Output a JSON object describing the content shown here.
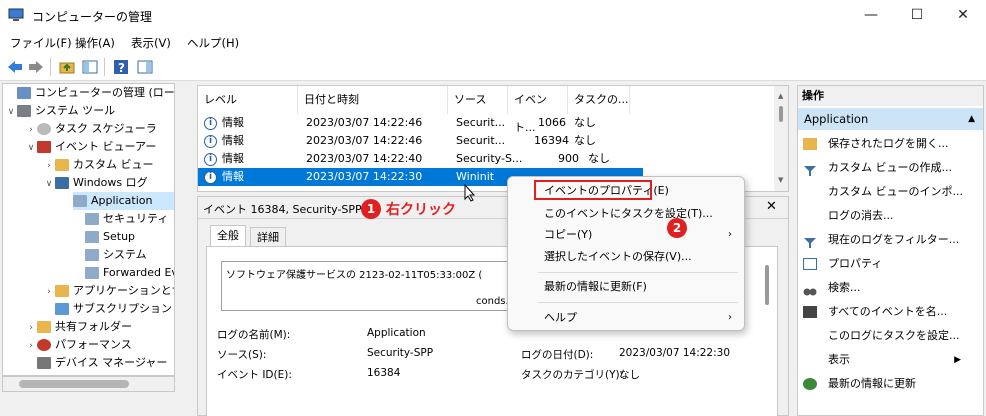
{
  "window": {
    "title": "コンピューターの管理",
    "minimize": "—",
    "maximize": "☐",
    "close": "✕"
  },
  "menu": [
    "ファイル(F)",
    "操作(A)",
    "表示(V)",
    "ヘルプ(H)"
  ],
  "tree": [
    {
      "label": "コンピューターの管理 (ローカル)"
    },
    {
      "label": "システム ツール"
    },
    {
      "label": "タスク スケジューラ"
    },
    {
      "label": "イベント ビューアー"
    },
    {
      "label": "カスタム ビュー"
    },
    {
      "label": "Windows ログ"
    },
    {
      "label": "Application"
    },
    {
      "label": "セキュリティ"
    },
    {
      "label": "Setup"
    },
    {
      "label": "システム"
    },
    {
      "label": "Forwarded Ev"
    },
    {
      "label": "アプリケーションとサ"
    },
    {
      "label": "サブスクリプション"
    },
    {
      "label": "共有フォルダー"
    },
    {
      "label": "パフォーマンス"
    },
    {
      "label": "デバイス マネージャー"
    }
  ],
  "list": {
    "headers": [
      "レベル",
      "日付と時刻",
      "ソース",
      "イベント...",
      "タスクの..."
    ],
    "rows": [
      {
        "level": "情報",
        "date": "2023/03/07 14:22:46",
        "source": "Securit...",
        "id": "1066",
        "task": "なし"
      },
      {
        "level": "情報",
        "date": "2023/03/07 14:22:46",
        "source": "Securit...",
        "id": "16394",
        "task": "なし"
      },
      {
        "level": "情報",
        "date": "2023/03/07 14:22:40",
        "source": "Security-S...",
        "id": "900",
        "task": "なし"
      },
      {
        "level": "情報",
        "date": "2023/03/07 14:22:30",
        "source": "Wininit",
        "id": "",
        "task": ""
      }
    ]
  },
  "detail": {
    "header": "イベント 16384, Security-SPP",
    "tabs": [
      "全般",
      "詳細"
    ],
    "description": "ソフトウェア保護サービスの 2123-02-11T05:33:00Z (",
    "description2": "conds.",
    "fields": {
      "log_name_label": "ログの名前(M):",
      "log_name_value": "Application",
      "source_label": "ソース(S):",
      "source_value": "Security-SPP",
      "logged_label": "ログの日付(D):",
      "logged_value": "2023/03/07 14:22:30",
      "event_id_label": "イベント ID(E):",
      "event_id_value": "16384",
      "task_cat_label": "タスクのカテゴリ(Y):",
      "task_cat_value": "なし"
    }
  },
  "actions": {
    "header": "操作",
    "section": "Application",
    "items": [
      "保存されたログを開く...",
      "カスタム ビューの作成...",
      "カスタム ビューのインポ...",
      "ログの消去...",
      "現在のログをフィルター...",
      "プロパティ",
      "検索...",
      "すべてのイベントを名...",
      "このログにタスクを設定...",
      "表示",
      "最新の情報に更新"
    ]
  },
  "context_menu": {
    "items": [
      {
        "label": "イベントのプロパティ(E)",
        "arrow": ""
      },
      {
        "label": "このイベントにタスクを設定(T)...",
        "arrow": ""
      },
      {
        "label": "コピー(Y)",
        "arrow": "›"
      },
      {
        "label": "選択したイベントの保存(V)...",
        "arrow": ""
      },
      {
        "label": "最新の情報に更新(F)",
        "arrow": ""
      },
      {
        "label": "ヘルプ",
        "arrow": "›"
      }
    ]
  },
  "annotations": {
    "step1_num": "1",
    "step1_text": "右クリック",
    "step2_num": "2"
  },
  "colors": {
    "selection": "#0078d7",
    "highlight": "#e02020",
    "action_header": "#cde4f7"
  }
}
